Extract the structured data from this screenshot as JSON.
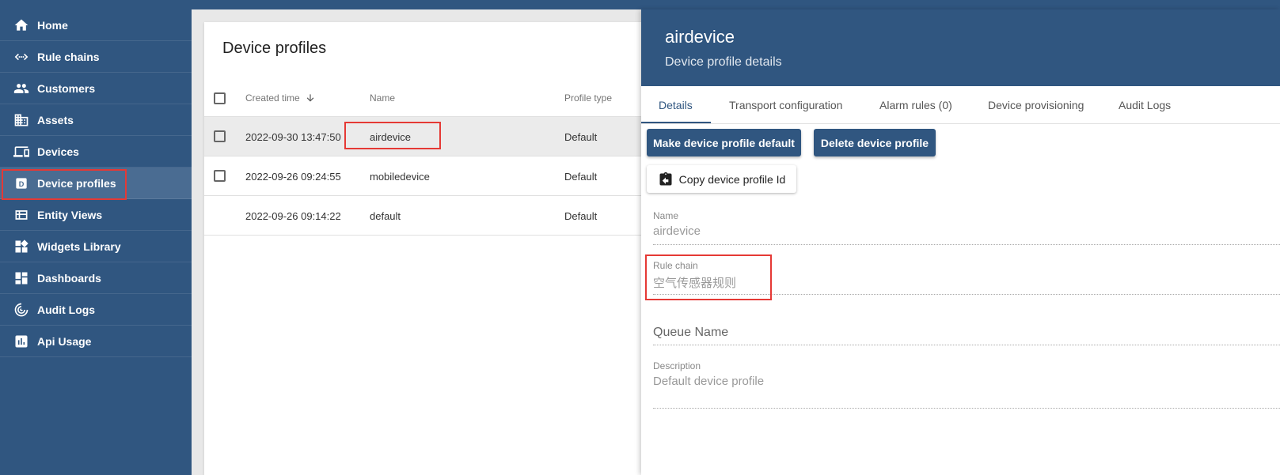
{
  "sidebar": {
    "items": [
      {
        "label": "Home",
        "icon": "home-icon"
      },
      {
        "label": "Rule chains",
        "icon": "rule-chain-icon"
      },
      {
        "label": "Customers",
        "icon": "customers-icon"
      },
      {
        "label": "Assets",
        "icon": "assets-icon"
      },
      {
        "label": "Devices",
        "icon": "devices-icon"
      },
      {
        "label": "Device profiles",
        "icon": "device-profile-icon"
      },
      {
        "label": "Entity Views",
        "icon": "entity-views-icon"
      },
      {
        "label": "Widgets Library",
        "icon": "widgets-icon"
      },
      {
        "label": "Dashboards",
        "icon": "dashboards-icon"
      },
      {
        "label": "Audit Logs",
        "icon": "audit-logs-icon"
      },
      {
        "label": "Api Usage",
        "icon": "api-usage-icon"
      }
    ],
    "active_index": 5,
    "color": "#305680"
  },
  "main": {
    "title": "Device profiles",
    "columns": {
      "created_time": "Created time",
      "name": "Name",
      "profile_type": "Profile type"
    },
    "rows": [
      {
        "created": "2022-09-30 13:47:50",
        "name": "airdevice",
        "type": "Default"
      },
      {
        "created": "2022-09-26 09:24:55",
        "name": "mobiledevice",
        "type": "Default"
      },
      {
        "created": "2022-09-26 09:14:22",
        "name": "default",
        "type": "Default"
      }
    ]
  },
  "panel": {
    "title": "airdevice",
    "subtitle": "Device profile details",
    "tabs": [
      "Details",
      "Transport configuration",
      "Alarm rules (0)",
      "Device provisioning",
      "Audit Logs"
    ],
    "buttons": {
      "make_default": "Make device profile default",
      "delete": "Delete device profile",
      "copy_id": "Copy device profile Id"
    },
    "fields": {
      "name_label": "Name",
      "name_value": "airdevice",
      "rule_chain_label": "Rule chain",
      "rule_chain_value": "空气传感器规则",
      "queue_name_label": "Queue Name",
      "description_label": "Description",
      "description_value": "Default device profile"
    }
  }
}
